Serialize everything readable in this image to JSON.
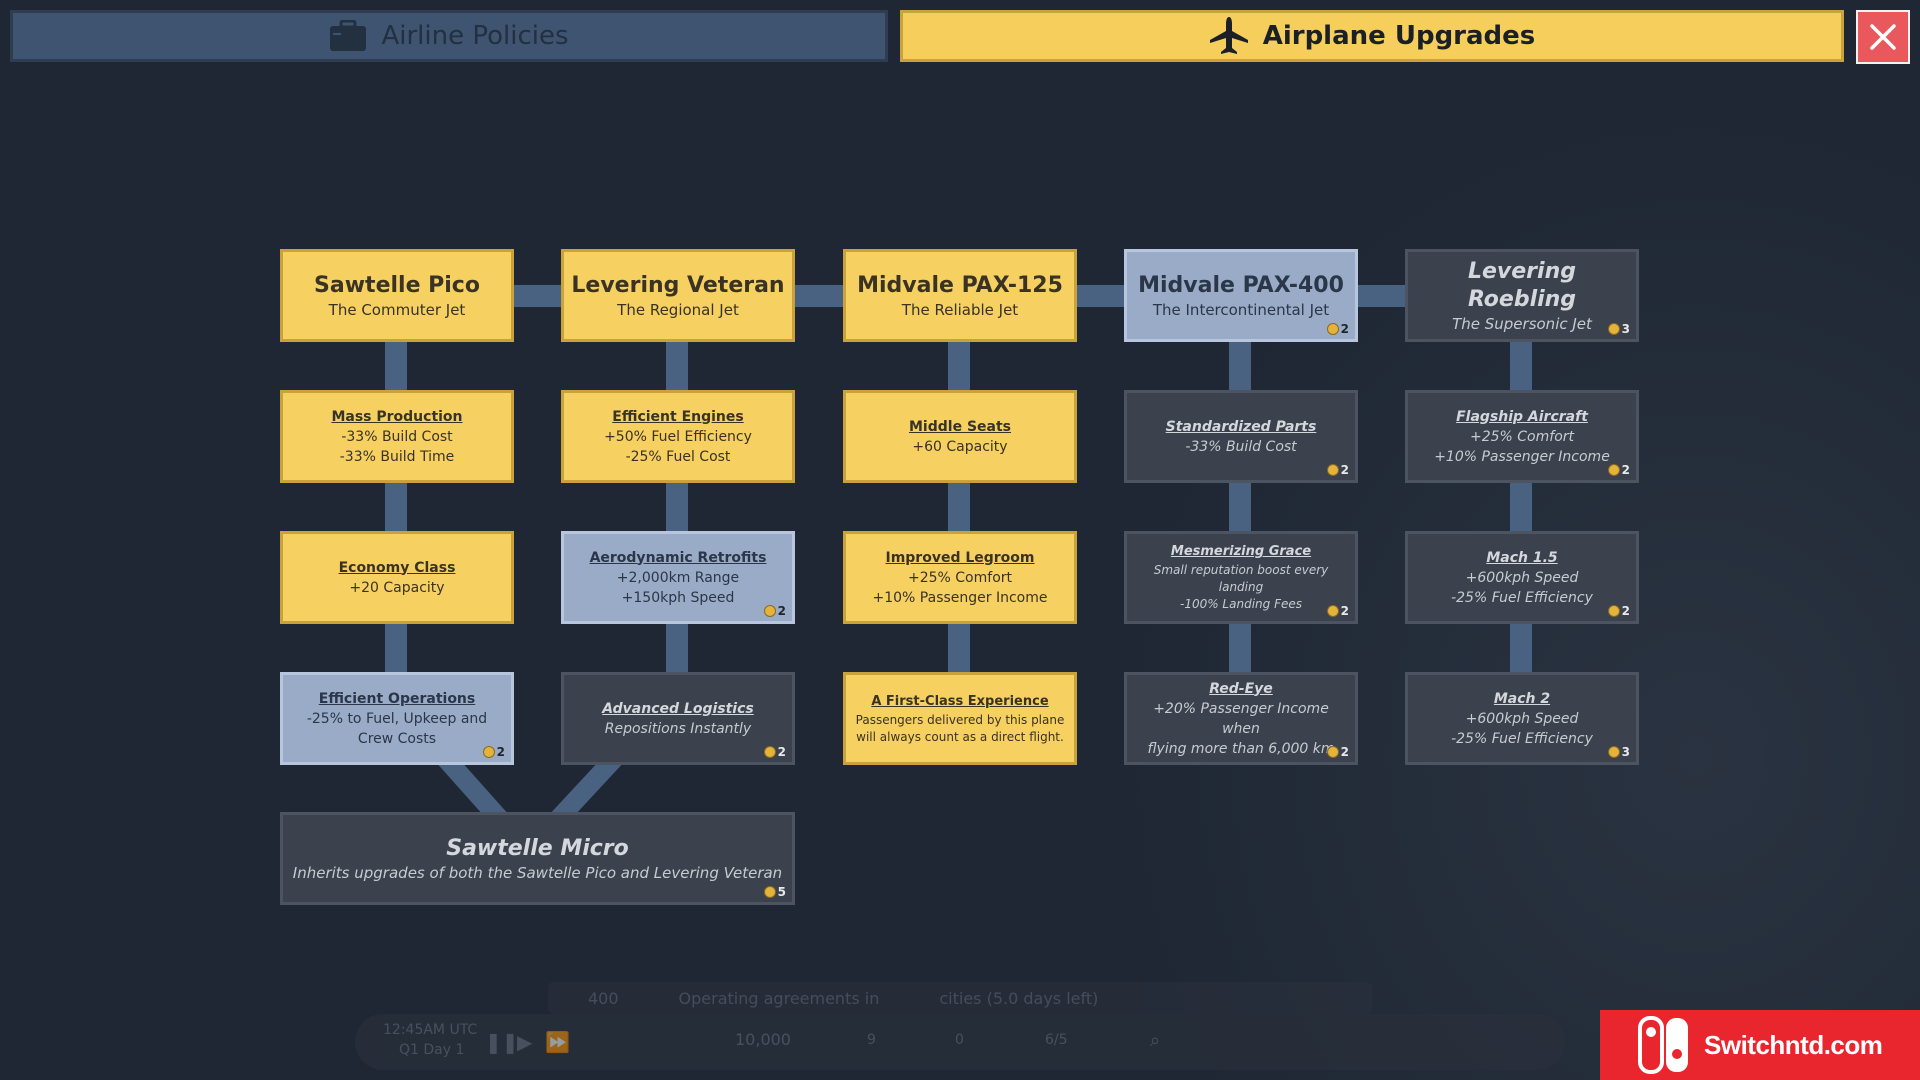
{
  "tabs": {
    "policies": "Airline Policies",
    "upgrades": "Airplane Upgrades"
  },
  "columns": [
    {
      "model": {
        "name": "Sawtelle Pico",
        "subtitle": "The Commuter Jet",
        "state": "owned",
        "cost": ""
      },
      "upgrades": [
        {
          "name": "Mass Production",
          "effects": [
            "-33% Build Cost",
            "-33% Build Time"
          ],
          "state": "owned",
          "cost": ""
        },
        {
          "name": "Economy Class",
          "effects": [
            "+20 Capacity"
          ],
          "state": "owned",
          "cost": ""
        },
        {
          "name": "Efficient Operations",
          "effects": [
            "-25% to Fuel, Upkeep and",
            "Crew Costs"
          ],
          "state": "avail",
          "cost": "2"
        }
      ]
    },
    {
      "model": {
        "name": "Levering Veteran",
        "subtitle": "The Regional Jet",
        "state": "owned",
        "cost": ""
      },
      "upgrades": [
        {
          "name": "Efficient Engines",
          "effects": [
            "+50% Fuel Efficiency",
            "-25% Fuel Cost"
          ],
          "state": "owned",
          "cost": ""
        },
        {
          "name": "Aerodynamic Retrofits",
          "effects": [
            "+2,000km Range",
            "+150kph Speed"
          ],
          "state": "avail",
          "cost": "2"
        },
        {
          "name": "Advanced Logistics",
          "effects": [
            "Repositions Instantly"
          ],
          "state": "locked",
          "cost": "2"
        }
      ]
    },
    {
      "model": {
        "name": "Midvale PAX-125",
        "subtitle": "The Reliable Jet",
        "state": "owned",
        "cost": ""
      },
      "upgrades": [
        {
          "name": "Middle Seats",
          "effects": [
            "+60 Capacity"
          ],
          "state": "owned",
          "cost": ""
        },
        {
          "name": "Improved Legroom",
          "effects": [
            "+25% Comfort",
            "+10% Passenger Income"
          ],
          "state": "owned",
          "cost": ""
        },
        {
          "name": "A First-Class Experience",
          "effects": [
            "Passengers delivered by this plane",
            "will always count as a direct flight."
          ],
          "state": "owned",
          "cost": "",
          "small": true
        }
      ]
    },
    {
      "model": {
        "name": "Midvale PAX-400",
        "subtitle": "The Intercontinental Jet",
        "state": "avail",
        "cost": "2"
      },
      "upgrades": [
        {
          "name": "Standardized Parts",
          "effects": [
            "-33% Build Cost"
          ],
          "state": "locked",
          "cost": "2"
        },
        {
          "name": "Mesmerizing Grace",
          "effects": [
            "Small reputation boost every landing",
            "-100% Landing Fees"
          ],
          "state": "locked",
          "cost": "2",
          "small": true
        },
        {
          "name": "Red-Eye",
          "effects": [
            "+20% Passenger Income when",
            "flying more than 6,000 km"
          ],
          "state": "locked",
          "cost": "2"
        }
      ]
    },
    {
      "model": {
        "name": "Levering Roebling",
        "subtitle": "The Supersonic Jet",
        "state": "locked",
        "cost": "3"
      },
      "upgrades": [
        {
          "name": "Flagship Aircraft",
          "effects": [
            "+25% Comfort",
            "+10% Passenger Income"
          ],
          "state": "locked",
          "cost": "2"
        },
        {
          "name": "Mach 1.5",
          "effects": [
            "+600kph Speed",
            "-25% Fuel Efficiency"
          ],
          "state": "locked",
          "cost": "2"
        },
        {
          "name": "Mach 2",
          "effects": [
            "+600kph Speed",
            "-25% Fuel Efficiency"
          ],
          "state": "locked",
          "cost": "3"
        }
      ]
    }
  ],
  "combined": {
    "name": "Sawtelle Micro",
    "description": "Inherits upgrades of both the Sawtelle Pico and Levering Veteran",
    "state": "locked",
    "cost": "5"
  },
  "hud": {
    "rank": "400",
    "agreements": "Operating agreements in",
    "cities_text": "cities (5.0 days left)",
    "time": "12:45AM UTC",
    "day": "Q1 Day 1",
    "money": "10,000",
    "planes": "9",
    "routes": "0",
    "hangar": "6/5"
  },
  "watermark": "Switchntd.com",
  "colors": {
    "owned": "#f6d061",
    "available": "#99abc6",
    "locked": "#3c424d",
    "background": "#1f2734",
    "close": "#e9585c"
  }
}
